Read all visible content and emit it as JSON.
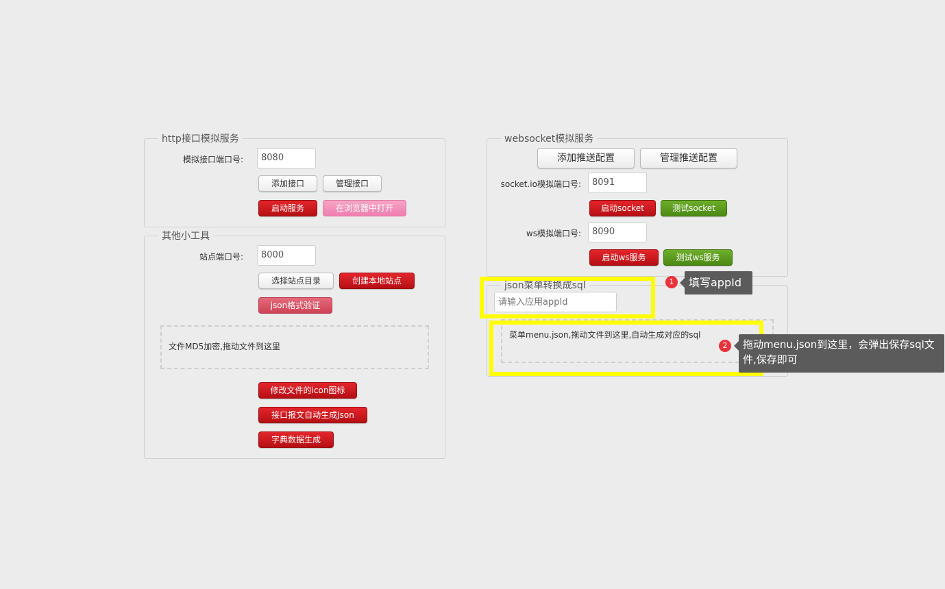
{
  "http_panel": {
    "title": "http接口模拟服务",
    "port_label": "模拟接口端口号:",
    "port_value": "8080",
    "add_api": "添加接口",
    "manage_api": "管理接口",
    "start_service": "启动服务",
    "open_browser": "在浏览器中打开"
  },
  "tools_panel": {
    "title": "其他小工具",
    "port_label": "站点端口号:",
    "port_value": "8000",
    "choose_dir": "选择站点目录",
    "create_site": "创建本地站点",
    "json_validate": "json格式验证",
    "md5_drop": "文件MD5加密,拖动文件到这里",
    "change_icon": "修改文件的icon图标",
    "gen_json": "接口报文自动生成Json",
    "dict_gen": "字典数据生成"
  },
  "ws_panel": {
    "title": "websocket模拟服务",
    "add_push": "添加推送配置",
    "manage_push": "管理推送配置",
    "socketio_label": "socket.io模拟端口号:",
    "socketio_value": "8091",
    "start_socket": "启动socket",
    "test_socket": "测试socket",
    "ws_label": "ws模拟端口号:",
    "ws_value": "8090",
    "start_ws": "启动ws服务",
    "test_ws": "测试ws服务"
  },
  "json_panel": {
    "title": "json菜单转换成sql",
    "appid_placeholder": "请输入应用appId",
    "drop_text": "菜单menu.json,拖动文件到这里,自动生成对应的sql"
  },
  "annotations": {
    "step1_num": "1",
    "step1_text": "填写appId",
    "step2_num": "2",
    "step2_text": "拖动menu.json到这里，会弹出保存sql文件,保存即可"
  },
  "colors": {
    "highlight": "#ffff00",
    "primary_red": "#c8161c",
    "success_green": "#5a9a1d",
    "tooltip_bg": "#5b5b5b"
  }
}
